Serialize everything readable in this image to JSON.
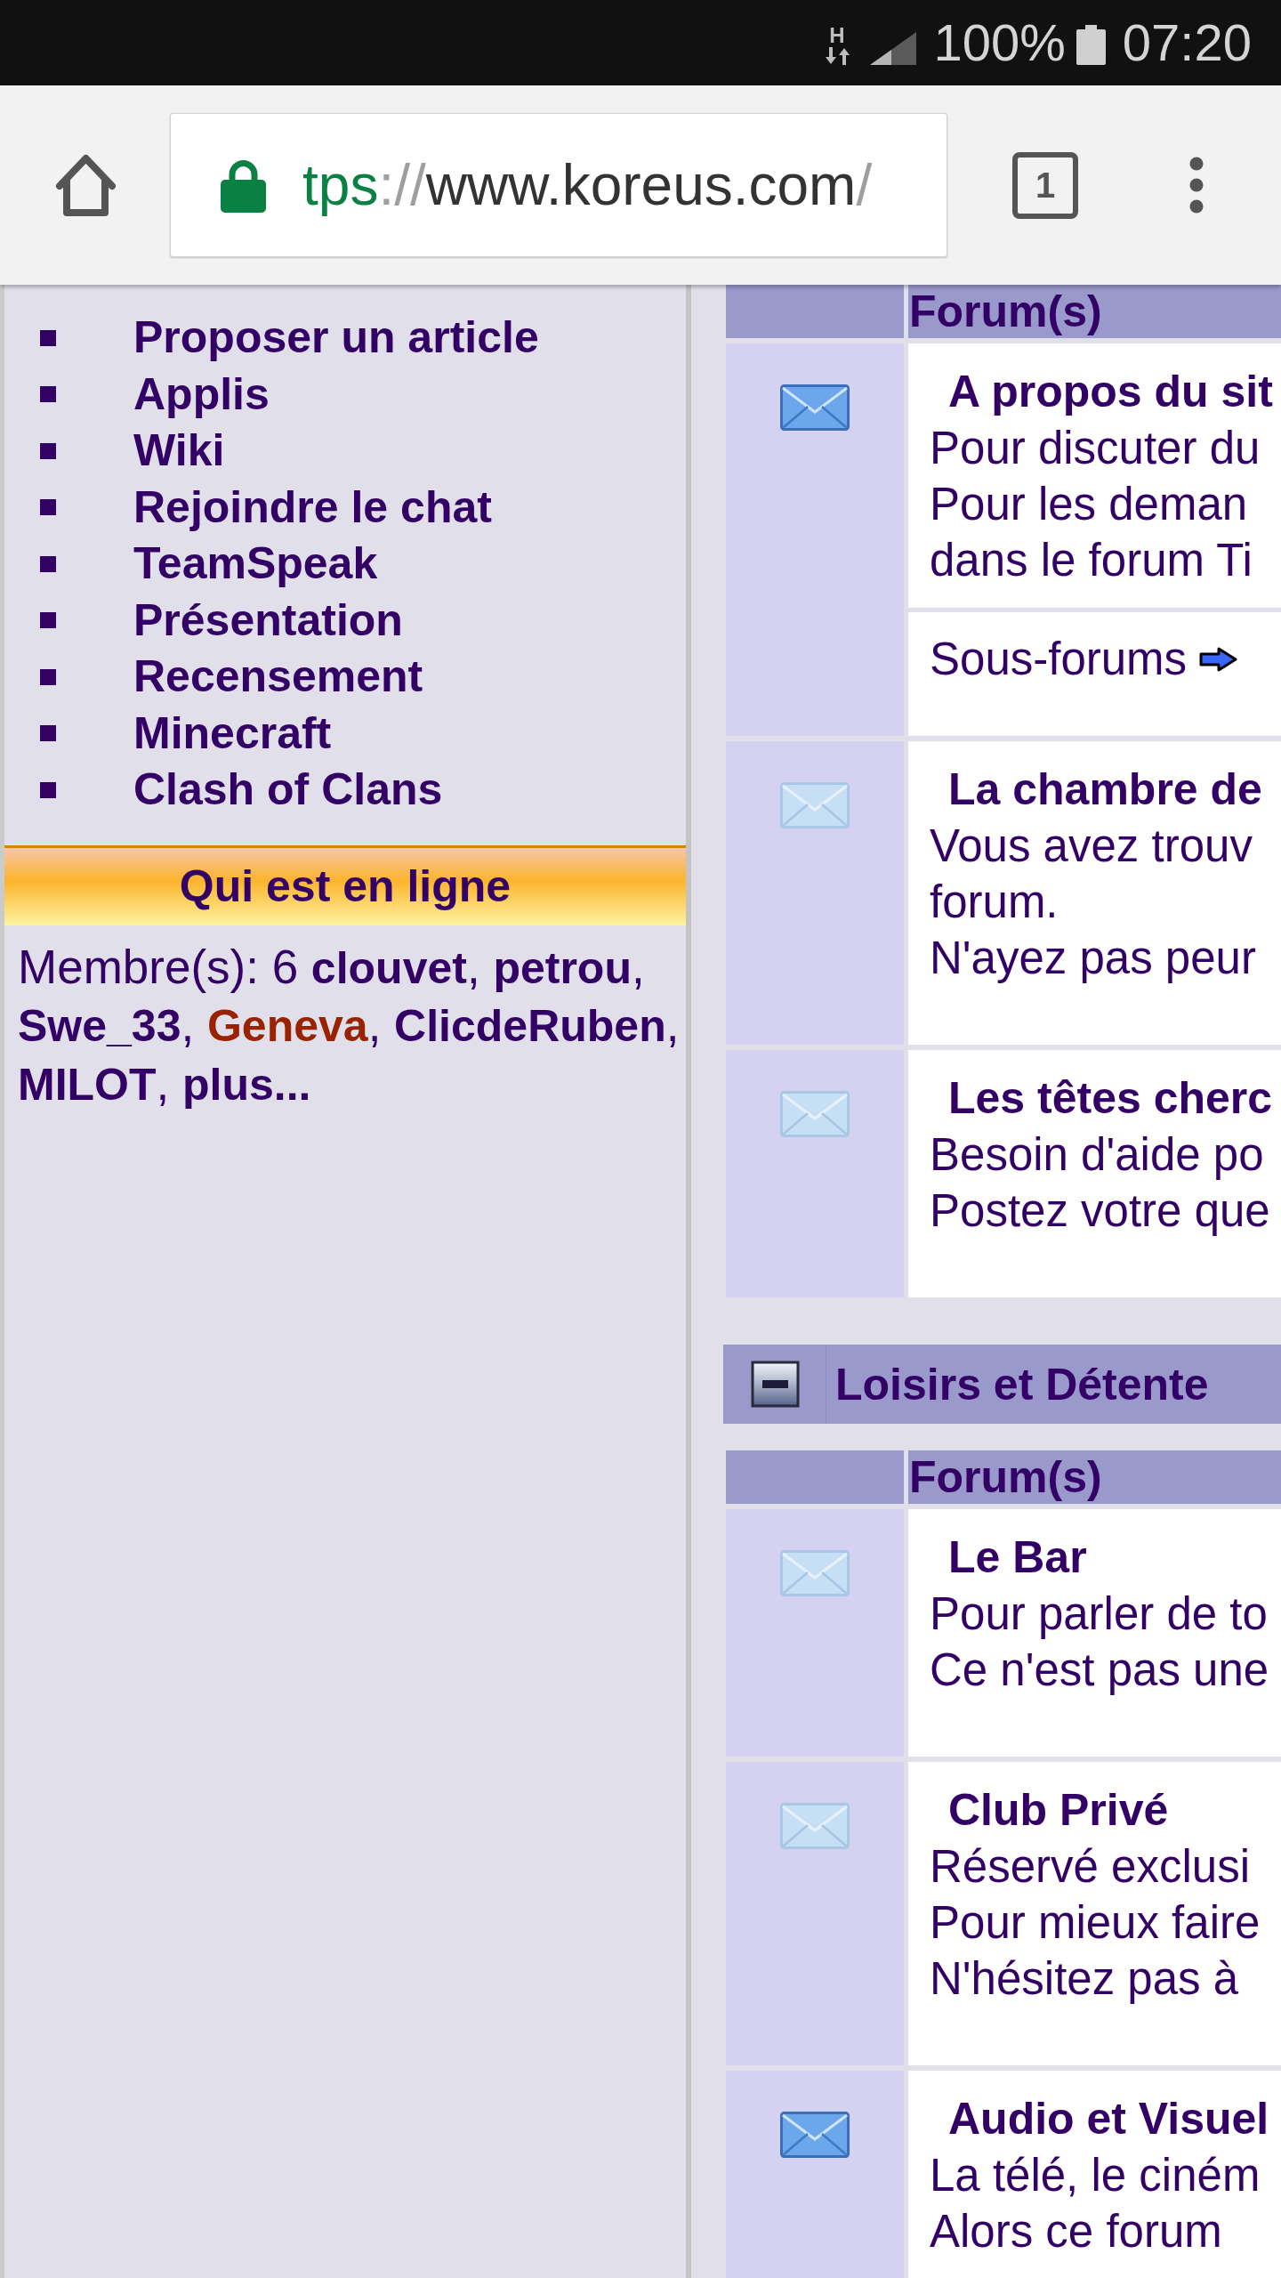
{
  "status_bar": {
    "network": "H",
    "battery": "100%",
    "time": "07:20"
  },
  "browser": {
    "url": {
      "scheme": "tps",
      "separator": "://",
      "host": "www.koreus.com",
      "path": "/"
    },
    "tab_count": "1"
  },
  "sidebar": {
    "links": [
      "Proposer un article",
      "Applis",
      "Wiki",
      "Rejoindre le chat",
      "TeamSpeak",
      "Présentation",
      "Recensement",
      "Minecraft",
      "Clash of Clans"
    ],
    "online": {
      "title": "Qui est en ligne",
      "count_label": "Membre(s): 6",
      "members": [
        {
          "name": "clouvet",
          "color": "#330066",
          "separator": ","
        },
        {
          "name": "petrou",
          "color": "#330066",
          "separator": ","
        },
        {
          "name": "Swe_33",
          "color": "#330066",
          "separator": ","
        },
        {
          "name": "Geneva",
          "color": "#992200",
          "separator": ","
        },
        {
          "name": "ClicdeRuben",
          "color": "#330066",
          "separator": ","
        },
        {
          "name": "MILOT",
          "color": "#330066",
          "separator": ","
        }
      ],
      "more": "plus..."
    }
  },
  "sections": [
    {
      "expanded": true,
      "column_header": "Forum(s)",
      "forums": [
        {
          "title": "A propos du sit",
          "new_posts": true,
          "lines": [
            "Pour discuter du",
            "Pour les deman",
            "dans le forum Ti"
          ],
          "subforums": "Sous-forums"
        },
        {
          "title": "La chambre de",
          "new_posts": false,
          "lines": [
            "Vous avez trouv",
            "forum.",
            "N'ayez pas peur"
          ]
        },
        {
          "title": "Les têtes cherc",
          "new_posts": false,
          "lines": [
            "Besoin d'aide po",
            "Postez votre que"
          ]
        }
      ]
    },
    {
      "title": "Loisirs et Détente",
      "expanded": true,
      "column_header": "Forum(s)",
      "forums": [
        {
          "title": "Le Bar",
          "new_posts": false,
          "lines": [
            "Pour parler de to",
            "Ce n'est pas une"
          ]
        },
        {
          "title": "Club Privé",
          "new_posts": false,
          "lines": [
            "Réservé exclusi",
            "Pour mieux faire",
            "N'hésitez pas à"
          ]
        },
        {
          "title": "Audio et Visuel",
          "new_posts": true,
          "lines": [
            "La télé, le ciném",
            "Alors ce forum"
          ]
        }
      ]
    }
  ]
}
